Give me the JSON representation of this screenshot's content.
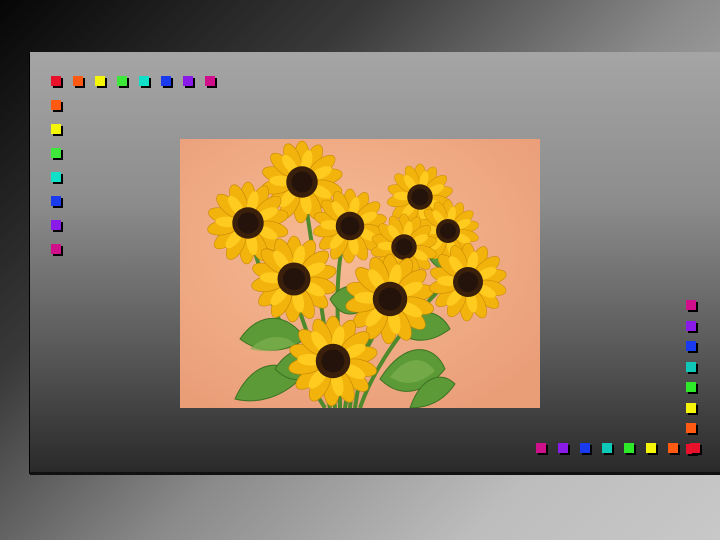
{
  "slide": {
    "background": "gradient-gray",
    "panel_color": "#9a9a9a"
  },
  "decoration": {
    "top_left_row_colors": [
      "#e8102a",
      "#ff5a14",
      "#f5f50a",
      "#3ee83a",
      "#10e0c8",
      "#1a3af0",
      "#8a1ae8",
      "#d0108a"
    ],
    "left_column_colors": [
      "#ff5a14",
      "#f5f50a",
      "#3ee83a",
      "#10e0c8",
      "#1a3af0",
      "#8a1ae8",
      "#d0108a"
    ],
    "right_column_colors": [
      "#d0108a",
      "#8a1ae8",
      "#1a3af0",
      "#10c8b8",
      "#2ee82a",
      "#f5f50a",
      "#ff5a14",
      "#e8102a"
    ],
    "bottom_row_colors": [
      "#d0108a",
      "#8a1ae8",
      "#1a3af0",
      "#10c8b8",
      "#2ee82a",
      "#f5f50a",
      "#ff5a14",
      "#e8102a"
    ]
  },
  "image": {
    "subject": "sunflowers",
    "background_color": "#f1ad85"
  }
}
